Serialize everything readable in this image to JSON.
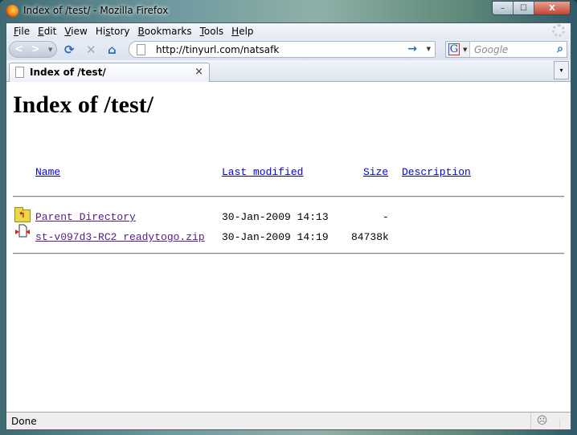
{
  "window": {
    "title": "Index of /test/ - Mozilla Firefox",
    "minimize": "–",
    "maximize": "☐",
    "close": "X"
  },
  "menu": [
    {
      "label": "File",
      "key": "F",
      "rest": "ile"
    },
    {
      "label": "Edit",
      "key": "E",
      "rest": "dit"
    },
    {
      "label": "View",
      "key": "V",
      "rest": "iew"
    },
    {
      "label": "History",
      "pre": "Hi",
      "key": "s",
      "rest": "tory"
    },
    {
      "label": "Bookmarks",
      "key": "B",
      "rest": "ookmarks"
    },
    {
      "label": "Tools",
      "key": "T",
      "rest": "ools"
    },
    {
      "label": "Help",
      "key": "H",
      "rest": "elp"
    }
  ],
  "nav": {
    "back": "<",
    "forward": ">",
    "reload": "⟳",
    "stop": "✕",
    "home": "⌂",
    "url": "http://tinyurl.com/natsafk",
    "go": "→",
    "search_placeholder": "Google",
    "engine": "G",
    "search_icon": "⚲"
  },
  "tab": {
    "title": "Index of /test/",
    "close": "×",
    "list": "▾"
  },
  "page": {
    "heading": "Index of /test/",
    "columns": [
      "Name",
      "Last modified",
      "Size",
      "Description"
    ],
    "rows": [
      {
        "name": "Parent Directory",
        "modified": "30-Jan-2009 14:13",
        "size": "-",
        "description": "",
        "icon": "parent-folder-icon"
      },
      {
        "name": "st-v097d3-RC2 readytogo.zip",
        "modified": "30-Jan-2009 14:19",
        "size": "84738k",
        "description": "",
        "icon": "zip-file-icon"
      }
    ]
  },
  "status": {
    "text": "Done"
  }
}
